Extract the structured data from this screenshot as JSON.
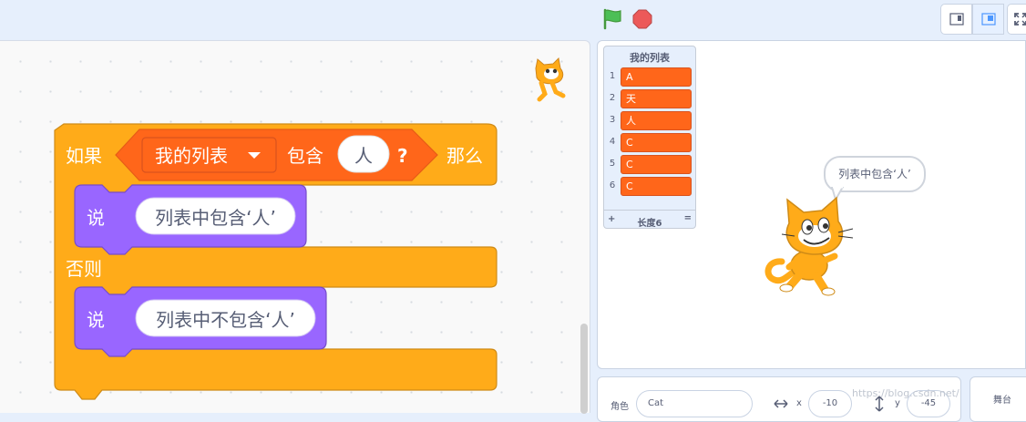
{
  "toolbar": {
    "green_flag_icon": "green-flag",
    "stop_icon": "stop-sign",
    "layout_buttons": [
      "small-stage-icon",
      "normal-stage-icon",
      "fullscreen-icon"
    ]
  },
  "code": {
    "if_label": "如果",
    "list_name": "我的列表",
    "contains_label": "包含",
    "contains_value": "人",
    "question_mark": "?",
    "then_label": "那么",
    "say1_label": "说",
    "say1_value": "列表中包含‘人’",
    "else_label": "否则",
    "say2_label": "说",
    "say2_value": "列表中不包含‘人’"
  },
  "stage": {
    "list_monitor": {
      "title": "我的列表",
      "items": [
        {
          "index": "1",
          "value": "A"
        },
        {
          "index": "2",
          "value": "天"
        },
        {
          "index": "3",
          "value": "人"
        },
        {
          "index": "4",
          "value": "C"
        },
        {
          "index": "5",
          "value": "C"
        },
        {
          "index": "6",
          "value": "C"
        }
      ],
      "add_label": "+",
      "length_label": "长度6",
      "resize_label": "="
    },
    "speech_bubble": "列表中包含‘人’"
  },
  "sprite_info": {
    "sprite_label": "角色",
    "sprite_name": "Cat",
    "x_label": "x",
    "x_value": "-10",
    "y_label": "y",
    "y_value": "-45"
  },
  "stage_panel": {
    "label": "舞台"
  },
  "watermark": "https://blog.csdn.net/"
}
